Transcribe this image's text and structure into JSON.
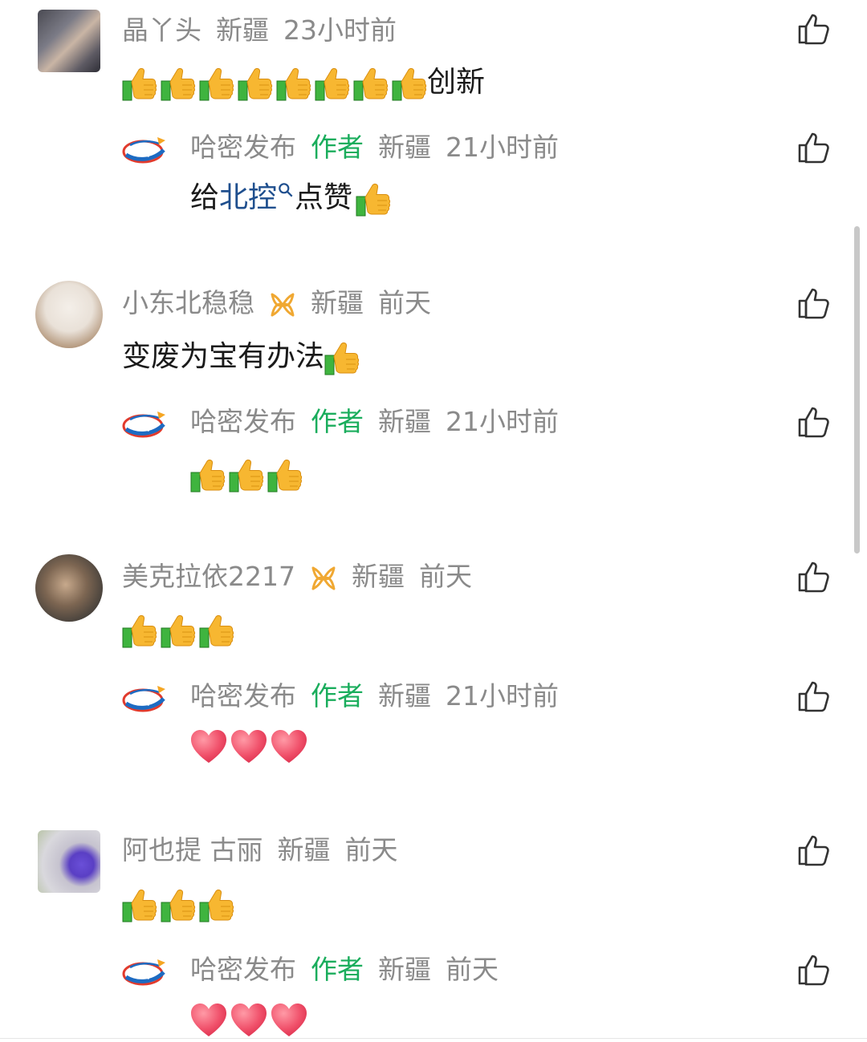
{
  "comments": [
    {
      "user": "晶丫头",
      "location": "新疆",
      "time": "23小时前",
      "text": "创新",
      "thumbs_before_text": 8,
      "reply": {
        "user": "哈密发布",
        "tag": "作者",
        "location": "新疆",
        "time": "21小时前",
        "text_prefix": "给",
        "link": "北控",
        "text_suffix": "点赞",
        "thumbs": 1
      }
    },
    {
      "user": "小东北稳稳",
      "location": "新疆",
      "time": "前天",
      "text": "变废为宝有办法",
      "thumbs_after_text": 1,
      "reply": {
        "user": "哈密发布",
        "tag": "作者",
        "location": "新疆",
        "time": "21小时前",
        "thumbs": 3
      }
    },
    {
      "user": "美克拉依2217",
      "location": "新疆",
      "time": "前天",
      "thumbs": 3,
      "reply": {
        "user": "哈密发布",
        "tag": "作者",
        "location": "新疆",
        "time": "21小时前",
        "hearts": 3
      }
    },
    {
      "user": "阿也提 古丽",
      "location": "新疆",
      "time": "前天",
      "thumbs": 3,
      "reply": {
        "user": "哈密发布",
        "tag": "作者",
        "location": "新疆",
        "time": "前天",
        "hearts": 3
      }
    }
  ],
  "icons": {
    "like": "thumbs-up-outline-icon",
    "thumb_emoji": "thumbs-up-emoji",
    "heart_emoji": "heart-emoji",
    "search": "search-icon",
    "badge": "ribbon-badge-icon",
    "publisher_logo": "hami-fabu-logo"
  },
  "colors": {
    "author_tag": "#1aad5c",
    "meta_text": "#8a8a8a",
    "link": "#1f4f8e",
    "badge": "#f0a832"
  }
}
